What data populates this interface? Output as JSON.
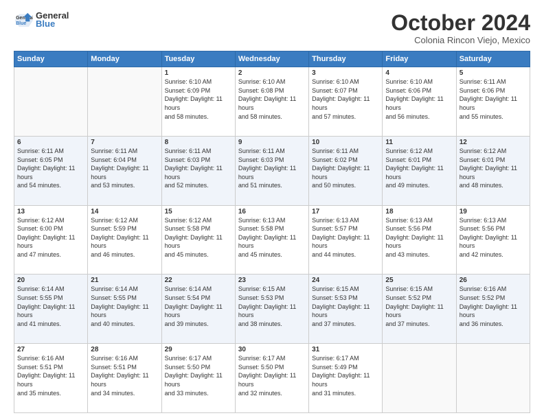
{
  "header": {
    "logo_general": "General",
    "logo_blue": "Blue",
    "month": "October 2024",
    "location": "Colonia Rincon Viejo, Mexico"
  },
  "days_of_week": [
    "Sunday",
    "Monday",
    "Tuesday",
    "Wednesday",
    "Thursday",
    "Friday",
    "Saturday"
  ],
  "weeks": [
    [
      {
        "day": "",
        "info": ""
      },
      {
        "day": "",
        "info": ""
      },
      {
        "day": "1",
        "info": "Sunrise: 6:10 AM\nSunset: 6:09 PM\nDaylight: 11 hours and 58 minutes."
      },
      {
        "day": "2",
        "info": "Sunrise: 6:10 AM\nSunset: 6:08 PM\nDaylight: 11 hours and 58 minutes."
      },
      {
        "day": "3",
        "info": "Sunrise: 6:10 AM\nSunset: 6:07 PM\nDaylight: 11 hours and 57 minutes."
      },
      {
        "day": "4",
        "info": "Sunrise: 6:10 AM\nSunset: 6:06 PM\nDaylight: 11 hours and 56 minutes."
      },
      {
        "day": "5",
        "info": "Sunrise: 6:11 AM\nSunset: 6:06 PM\nDaylight: 11 hours and 55 minutes."
      }
    ],
    [
      {
        "day": "6",
        "info": "Sunrise: 6:11 AM\nSunset: 6:05 PM\nDaylight: 11 hours and 54 minutes."
      },
      {
        "day": "7",
        "info": "Sunrise: 6:11 AM\nSunset: 6:04 PM\nDaylight: 11 hours and 53 minutes."
      },
      {
        "day": "8",
        "info": "Sunrise: 6:11 AM\nSunset: 6:03 PM\nDaylight: 11 hours and 52 minutes."
      },
      {
        "day": "9",
        "info": "Sunrise: 6:11 AM\nSunset: 6:03 PM\nDaylight: 11 hours and 51 minutes."
      },
      {
        "day": "10",
        "info": "Sunrise: 6:11 AM\nSunset: 6:02 PM\nDaylight: 11 hours and 50 minutes."
      },
      {
        "day": "11",
        "info": "Sunrise: 6:12 AM\nSunset: 6:01 PM\nDaylight: 11 hours and 49 minutes."
      },
      {
        "day": "12",
        "info": "Sunrise: 6:12 AM\nSunset: 6:01 PM\nDaylight: 11 hours and 48 minutes."
      }
    ],
    [
      {
        "day": "13",
        "info": "Sunrise: 6:12 AM\nSunset: 6:00 PM\nDaylight: 11 hours and 47 minutes."
      },
      {
        "day": "14",
        "info": "Sunrise: 6:12 AM\nSunset: 5:59 PM\nDaylight: 11 hours and 46 minutes."
      },
      {
        "day": "15",
        "info": "Sunrise: 6:12 AM\nSunset: 5:58 PM\nDaylight: 11 hours and 45 minutes."
      },
      {
        "day": "16",
        "info": "Sunrise: 6:13 AM\nSunset: 5:58 PM\nDaylight: 11 hours and 45 minutes."
      },
      {
        "day": "17",
        "info": "Sunrise: 6:13 AM\nSunset: 5:57 PM\nDaylight: 11 hours and 44 minutes."
      },
      {
        "day": "18",
        "info": "Sunrise: 6:13 AM\nSunset: 5:56 PM\nDaylight: 11 hours and 43 minutes."
      },
      {
        "day": "19",
        "info": "Sunrise: 6:13 AM\nSunset: 5:56 PM\nDaylight: 11 hours and 42 minutes."
      }
    ],
    [
      {
        "day": "20",
        "info": "Sunrise: 6:14 AM\nSunset: 5:55 PM\nDaylight: 11 hours and 41 minutes."
      },
      {
        "day": "21",
        "info": "Sunrise: 6:14 AM\nSunset: 5:55 PM\nDaylight: 11 hours and 40 minutes."
      },
      {
        "day": "22",
        "info": "Sunrise: 6:14 AM\nSunset: 5:54 PM\nDaylight: 11 hours and 39 minutes."
      },
      {
        "day": "23",
        "info": "Sunrise: 6:15 AM\nSunset: 5:53 PM\nDaylight: 11 hours and 38 minutes."
      },
      {
        "day": "24",
        "info": "Sunrise: 6:15 AM\nSunset: 5:53 PM\nDaylight: 11 hours and 37 minutes."
      },
      {
        "day": "25",
        "info": "Sunrise: 6:15 AM\nSunset: 5:52 PM\nDaylight: 11 hours and 37 minutes."
      },
      {
        "day": "26",
        "info": "Sunrise: 6:16 AM\nSunset: 5:52 PM\nDaylight: 11 hours and 36 minutes."
      }
    ],
    [
      {
        "day": "27",
        "info": "Sunrise: 6:16 AM\nSunset: 5:51 PM\nDaylight: 11 hours and 35 minutes."
      },
      {
        "day": "28",
        "info": "Sunrise: 6:16 AM\nSunset: 5:51 PM\nDaylight: 11 hours and 34 minutes."
      },
      {
        "day": "29",
        "info": "Sunrise: 6:17 AM\nSunset: 5:50 PM\nDaylight: 11 hours and 33 minutes."
      },
      {
        "day": "30",
        "info": "Sunrise: 6:17 AM\nSunset: 5:50 PM\nDaylight: 11 hours and 32 minutes."
      },
      {
        "day": "31",
        "info": "Sunrise: 6:17 AM\nSunset: 5:49 PM\nDaylight: 11 hours and 31 minutes."
      },
      {
        "day": "",
        "info": ""
      },
      {
        "day": "",
        "info": ""
      }
    ]
  ]
}
